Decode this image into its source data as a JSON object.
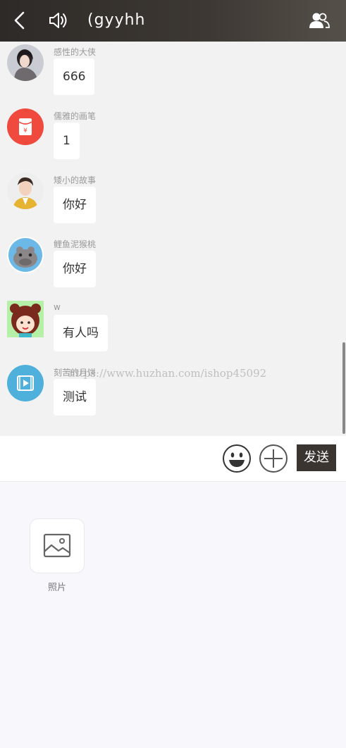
{
  "header": {
    "title": "(gyyhh",
    "back_icon": "chevron-left-icon",
    "sound_icon": "speaker-icon",
    "members_icon": "group-icon"
  },
  "messages": [
    {
      "name": "感性的大侠",
      "text": "666",
      "avatar": "portrait-woman"
    },
    {
      "name": "儒雅的画笔",
      "text": "1",
      "avatar": "red-envelope-icon"
    },
    {
      "name": "矮小的故事",
      "text": "你好",
      "avatar": "portrait-boy"
    },
    {
      "name": "鲤鱼泥猴桃",
      "text": "你好",
      "avatar": "hippo-cartoon"
    },
    {
      "name": "w",
      "text": "有人吗",
      "avatar": "bear-girl-cartoon"
    },
    {
      "name": "刻苦的月饼",
      "text": "测试",
      "avatar": "video-icon"
    }
  ],
  "watermark": "https://www.huzhan.com/ishop45092",
  "input": {
    "placeholder": "",
    "send_label": "发送"
  },
  "panel": {
    "items": [
      {
        "label": "照片",
        "icon": "image-icon"
      }
    ]
  },
  "colors": {
    "header": "#3a3531",
    "send": "#3b3532",
    "red_envelope": "#f04a3e",
    "video_bg": "#4fb0dc"
  }
}
